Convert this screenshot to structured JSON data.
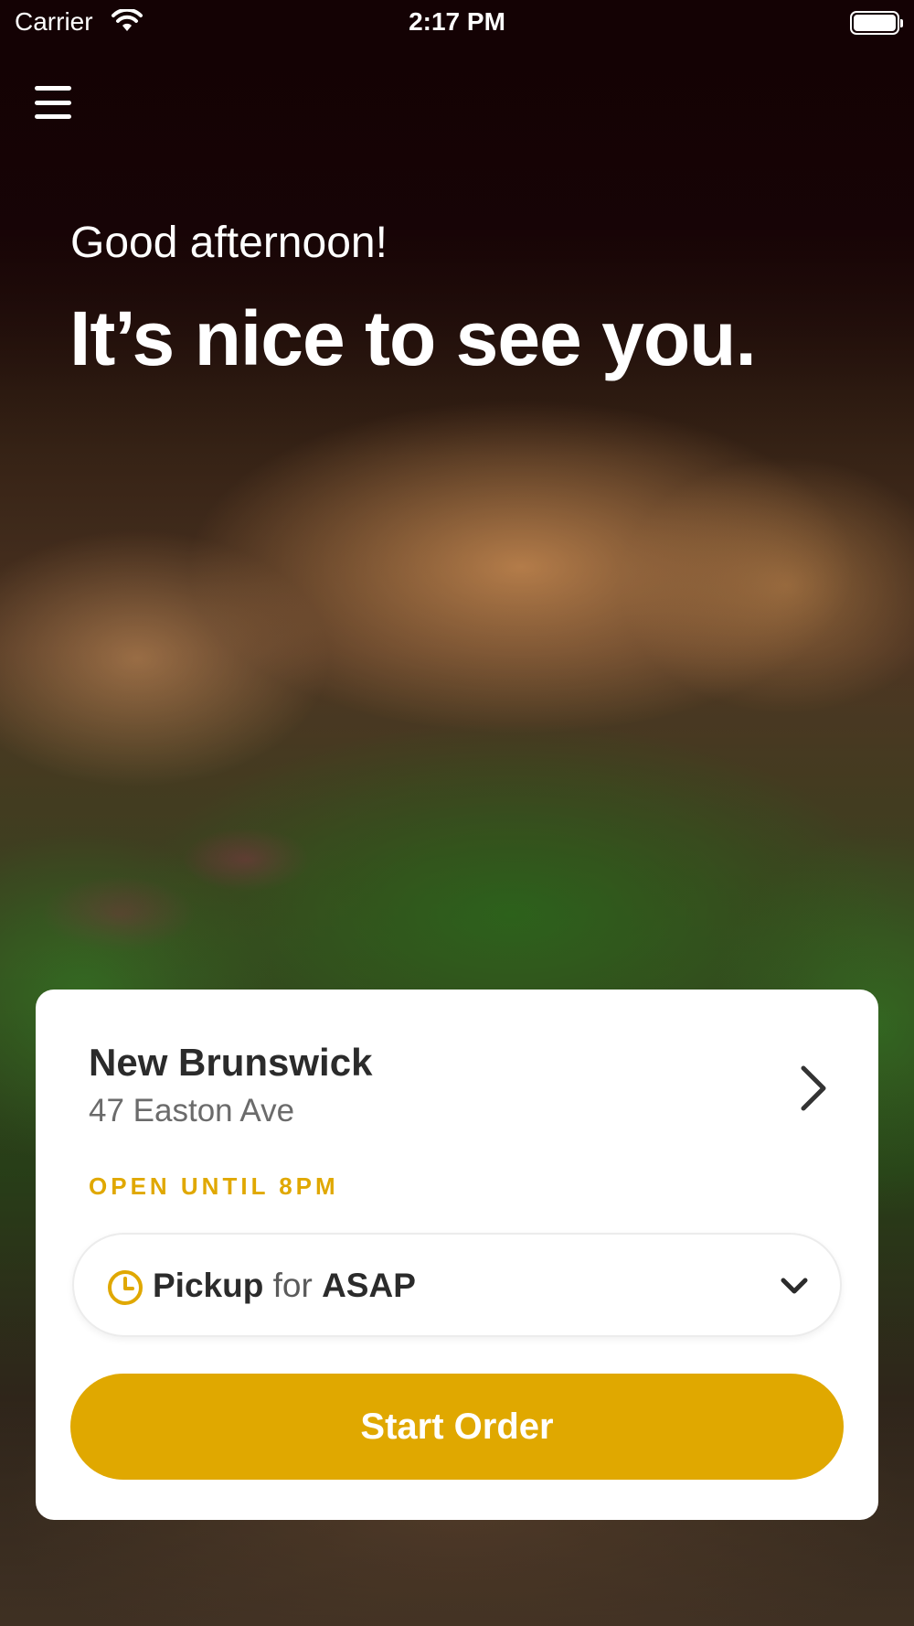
{
  "status_bar": {
    "carrier": "Carrier",
    "time": "2:17 PM"
  },
  "header": {
    "menu_icon": "hamburger-menu-icon"
  },
  "hero": {
    "greeting": "Good afternoon!",
    "headline": "It’s nice to see you."
  },
  "location_card": {
    "name": "New Brunswick",
    "address": "47 Easton Ave",
    "hours_status": "OPEN UNTIL 8PM",
    "order_mode": {
      "method": "Pickup",
      "connector": "for",
      "time": "ASAP"
    },
    "start_button_label": "Start Order"
  },
  "colors": {
    "accent": "#E0A800",
    "card_background": "#FFFFFF",
    "text_primary": "#2B2B2B",
    "text_secondary": "#6B6B6B"
  }
}
